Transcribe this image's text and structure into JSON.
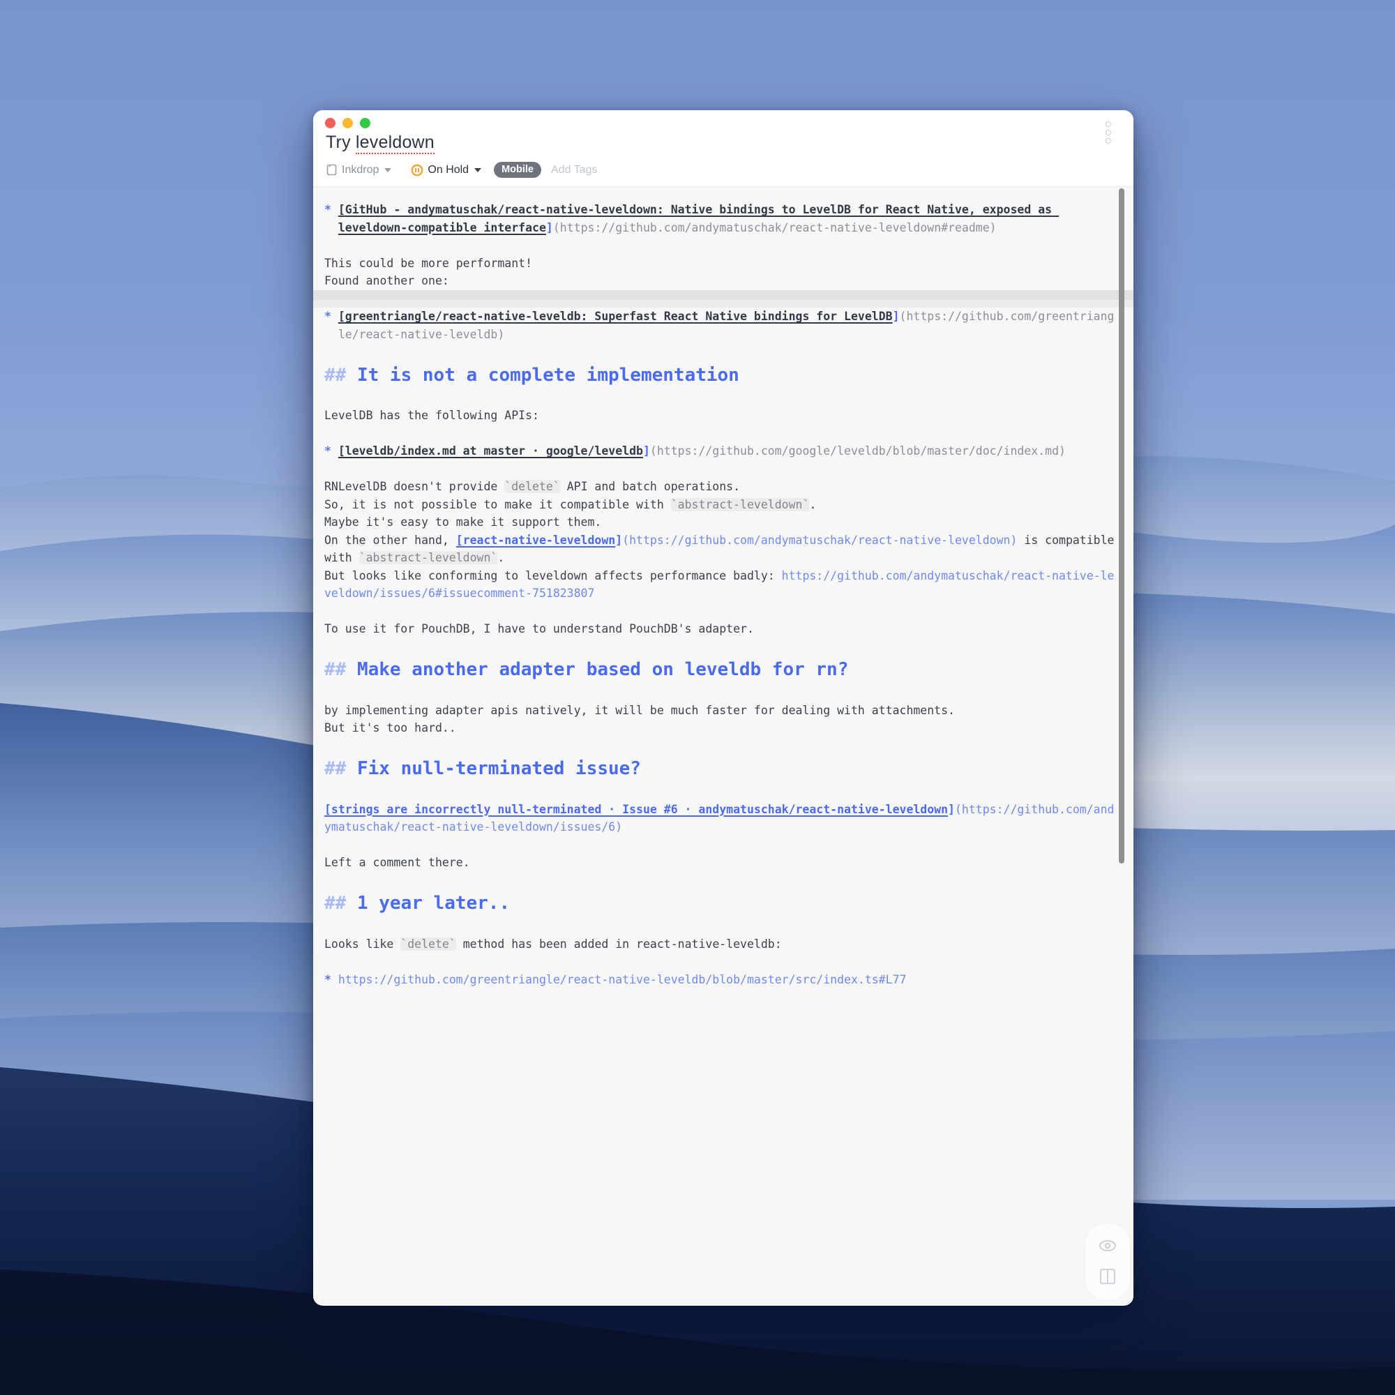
{
  "window": {
    "title_prefix": "Try ",
    "title_misspelled": "leveldown",
    "toolbar": {
      "notebook_label": "Inkdrop",
      "status_label": "On Hold",
      "tag": "Mobile",
      "add_tags_placeholder": "Add Tags"
    }
  },
  "colors": {
    "heading_blue": "#4a6af0",
    "hash_blue": "#a6baf6",
    "link_dark": "#333a47",
    "url_gray": "#8a8f9a",
    "url_blue": "#6f8af0",
    "editor_bg": "#f7f7f8",
    "active_line": "#e3e3e4",
    "tag_pill_bg": "#6e747c",
    "status_icon": "#f2a33c",
    "traffic_red": "#f3605a",
    "traffic_yellow": "#f8b82f",
    "traffic_green": "#35c948"
  },
  "editor": {
    "blocks": [
      {
        "t": "line",
        "s": [
          [
            "bullet",
            "* "
          ],
          [
            "linkDark",
            "[GitHub - andymatuschak/react-native-leveldown: Native bindings to LevelDB for React Native, exposed as "
          ]
        ]
      },
      {
        "t": "line",
        "s": [
          [
            "plain",
            "  "
          ],
          [
            "linkDark",
            "leveldown-compatible interface"
          ],
          [
            "bracket",
            "]"
          ],
          [
            "urlGray",
            "(https://github.com/andymatuschak/react-native-leveldown#readme)"
          ]
        ]
      },
      {
        "t": "blank"
      },
      {
        "t": "line",
        "s": [
          [
            "plain",
            "This could be more performant!"
          ]
        ]
      },
      {
        "t": "line",
        "s": [
          [
            "plain",
            "Found another one:"
          ]
        ]
      },
      {
        "t": "highlight"
      },
      {
        "t": "line",
        "s": [
          [
            "bullet",
            "* "
          ],
          [
            "linkDark",
            "[greentriangle/react-native-leveldb: Superfast React Native bindings for LevelDB"
          ],
          [
            "bracket",
            "]"
          ],
          [
            "urlGray",
            "(https://github.com/greentriang"
          ]
        ]
      },
      {
        "t": "line",
        "s": [
          [
            "plain",
            "  "
          ],
          [
            "urlGray",
            "le/react-native-leveldb)"
          ]
        ]
      },
      {
        "t": "blank"
      },
      {
        "t": "heading",
        "s": [
          [
            "hash",
            "## "
          ],
          [
            "htext",
            "It is not a complete implementation"
          ]
        ]
      },
      {
        "t": "blank"
      },
      {
        "t": "line",
        "s": [
          [
            "plain",
            "LevelDB has the following APIs:"
          ]
        ]
      },
      {
        "t": "blank"
      },
      {
        "t": "line",
        "s": [
          [
            "bullet",
            "* "
          ],
          [
            "linkDark",
            "[leveldb/index.md at master · google/leveldb"
          ],
          [
            "bracket",
            "]"
          ],
          [
            "urlGray",
            "(https://github.com/google/leveldb/blob/master/doc/index.md)"
          ]
        ]
      },
      {
        "t": "blank"
      },
      {
        "t": "line",
        "s": [
          [
            "plain",
            "RNLevelDB doesn't provide "
          ],
          [
            "code",
            "`delete`"
          ],
          [
            "plain",
            " API and batch operations."
          ]
        ]
      },
      {
        "t": "line",
        "s": [
          [
            "plain",
            "So, it is not possible to make it compatible with "
          ],
          [
            "code",
            "`abstract-leveldown`"
          ],
          [
            "plain",
            "."
          ]
        ]
      },
      {
        "t": "line",
        "s": [
          [
            "plain",
            "Maybe it's easy to make it support them."
          ]
        ]
      },
      {
        "t": "line",
        "s": [
          [
            "plain",
            "On the other hand, "
          ],
          [
            "linkBlue",
            "[react-native-leveldown"
          ],
          [
            "bracket",
            "]"
          ],
          [
            "urlBlue",
            "(https://github.com/andymatuschak/react-native-leveldown)"
          ],
          [
            "plain",
            " is compatible"
          ]
        ]
      },
      {
        "t": "line",
        "s": [
          [
            "plain",
            "with "
          ],
          [
            "code",
            "`abstract-leveldown`"
          ],
          [
            "plain",
            "."
          ]
        ]
      },
      {
        "t": "line",
        "s": [
          [
            "plain",
            "But looks like conforming to leveldown affects performance badly: "
          ],
          [
            "urlBlue",
            "https://github.com/andymatuschak/react-native-le"
          ]
        ]
      },
      {
        "t": "line",
        "s": [
          [
            "urlBlue",
            "veldown/issues/6#issuecomment-751823807"
          ]
        ]
      },
      {
        "t": "blank"
      },
      {
        "t": "line",
        "s": [
          [
            "plain",
            "To use it for PouchDB, I have to understand PouchDB's adapter."
          ]
        ]
      },
      {
        "t": "blank"
      },
      {
        "t": "heading",
        "s": [
          [
            "hash",
            "## "
          ],
          [
            "htext",
            "Make another adapter based on leveldb for rn?"
          ]
        ]
      },
      {
        "t": "blank"
      },
      {
        "t": "line",
        "s": [
          [
            "plain",
            "by implementing adapter apis natively, it will be much faster for dealing with attachments."
          ]
        ]
      },
      {
        "t": "line",
        "s": [
          [
            "plain",
            "But it's too hard.."
          ]
        ]
      },
      {
        "t": "blank"
      },
      {
        "t": "heading",
        "s": [
          [
            "hash",
            "## "
          ],
          [
            "htext",
            "Fix null-terminated issue?"
          ]
        ]
      },
      {
        "t": "blank"
      },
      {
        "t": "line",
        "s": [
          [
            "linkBlue",
            "[strings are incorrectly null-terminated · Issue #6 · andymatuschak/react-native-leveldown"
          ],
          [
            "bracket",
            "]"
          ],
          [
            "urlBlue",
            "(https://github.com/and"
          ]
        ]
      },
      {
        "t": "line",
        "s": [
          [
            "urlBlue",
            "ymatuschak/react-native-leveldown/issues/6)"
          ]
        ]
      },
      {
        "t": "blank"
      },
      {
        "t": "line",
        "s": [
          [
            "plain",
            "Left a comment there."
          ]
        ]
      },
      {
        "t": "blank"
      },
      {
        "t": "heading",
        "s": [
          [
            "hash",
            "## "
          ],
          [
            "htext",
            "1 year later.."
          ]
        ]
      },
      {
        "t": "blank"
      },
      {
        "t": "line",
        "s": [
          [
            "plain",
            "Looks like "
          ],
          [
            "code",
            "`delete`"
          ],
          [
            "plain",
            " method has been added in react-native-leveldb:"
          ]
        ]
      },
      {
        "t": "blank"
      },
      {
        "t": "line",
        "s": [
          [
            "bullet",
            "* "
          ],
          [
            "urlBlue",
            "https://github.com/greentriangle/react-native-leveldb/blob/master/src/index.ts#L77"
          ]
        ]
      }
    ]
  }
}
